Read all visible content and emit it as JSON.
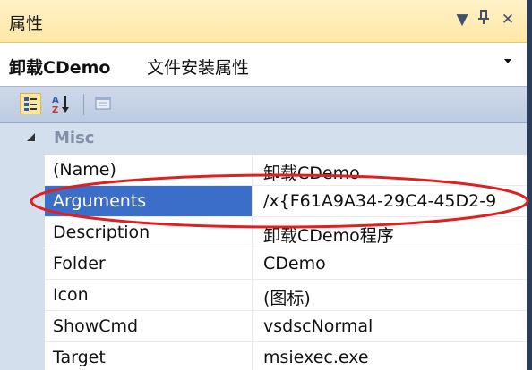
{
  "header": {
    "title": "属性",
    "dropdown_icon": "▼",
    "pin_icon": "ᛘ",
    "close_icon": "✕"
  },
  "object_selector": {
    "name": "卸载CDemo",
    "type_label": "文件安装属性",
    "arrow": "▾"
  },
  "toolbar": {
    "sort_icon_text": "A↓"
  },
  "category": {
    "arrow": "◢",
    "label": "Misc"
  },
  "properties": [
    {
      "name": "(Name)",
      "value": "卸载CDemo"
    },
    {
      "name": "Arguments",
      "value": "/x{F61A9A34-29C4-45D2-9"
    },
    {
      "name": "Description",
      "value": "卸载CDemo程序"
    },
    {
      "name": "Folder",
      "value": "CDemo"
    },
    {
      "name": "Icon",
      "value": "(图标)"
    },
    {
      "name": "ShowCmd",
      "value": "vsdscNormal"
    },
    {
      "name": "Target",
      "value": "msiexec.exe"
    }
  ],
  "selected_property": "Arguments",
  "colors": {
    "title_bar": "#ffe8a6",
    "selection": "#3b6ec8",
    "annotation": "#e02020",
    "frame": "#2b3c59"
  }
}
